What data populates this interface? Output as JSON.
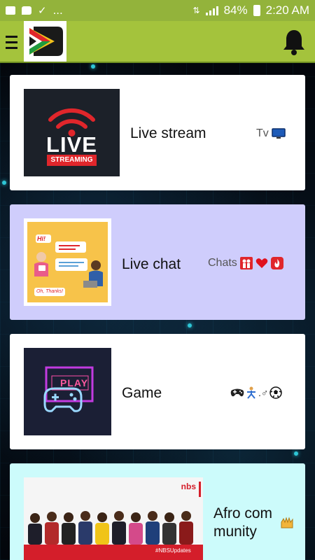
{
  "status_bar": {
    "left_dots": "...",
    "battery": "84%",
    "time": "2:20 AM"
  },
  "app_bar": {
    "menu_icon": "hamburger-menu-icon",
    "logo_icon": "app-logo-icon",
    "notification_icon": "bell-icon"
  },
  "cards": [
    {
      "title": "Live stream",
      "tag": "Tv",
      "tag_icons": [
        "tv-icon"
      ],
      "thumbnail": {
        "big": "LIVE",
        "small": "STREAMING"
      },
      "background": "#ffffff"
    },
    {
      "title": "Live chat",
      "tag": "Chats",
      "tag_icons": [
        "couple-icon",
        "heart-icon",
        "fire-icon"
      ],
      "thumbnail": {
        "bubble_hi": "Hi!",
        "bubble_thanks": "Oh, Thanks!"
      },
      "background": "#cfcdfc"
    },
    {
      "title": "Game",
      "tag": "",
      "tag_icons": [
        "gamepad-icon",
        "cartwheel-icon",
        "soccer-ball-icon"
      ],
      "tag_text": ".♂",
      "thumbnail": {
        "label": "PLAY"
      },
      "background": "#ffffff"
    },
    {
      "title_line1": "Afro com",
      "title_line2": "munity",
      "tag_icons": [
        "hands-icon"
      ],
      "thumbnail": {
        "brand": "nbs",
        "hashtag": "#NBSUpdates"
      },
      "background": "#ccfbfb"
    }
  ],
  "colors": {
    "status_bar": "#93b33b",
    "app_bar": "#a4c33c",
    "accent_red": "#e0262b",
    "chat_card": "#cfcdfc",
    "community_card": "#ccfbfb"
  }
}
